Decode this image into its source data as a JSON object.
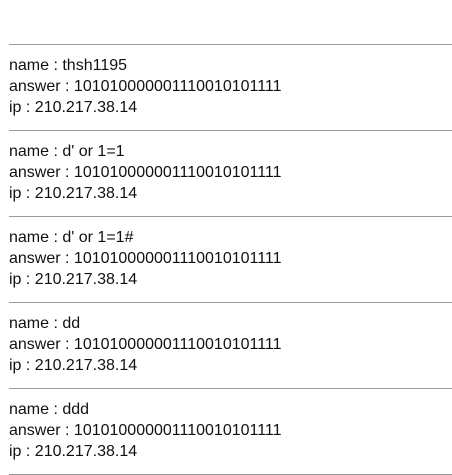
{
  "entries": [
    {
      "name_label": "name : thsh1195",
      "answer_label": "answer : 101010000001110010101111",
      "ip_label": "ip : 210.217.38.14"
    },
    {
      "name_label": "name : d' or 1=1",
      "answer_label": "answer : 101010000001110010101111",
      "ip_label": "ip : 210.217.38.14"
    },
    {
      "name_label": "name : d' or 1=1#",
      "answer_label": "answer : 101010000001110010101111",
      "ip_label": "ip : 210.217.38.14"
    },
    {
      "name_label": "name : dd",
      "answer_label": "answer : 101010000001110010101111",
      "ip_label": "ip : 210.217.38.14"
    },
    {
      "name_label": "name : ddd",
      "answer_label": "answer : 101010000001110010101111",
      "ip_label": "ip : 210.217.38.14"
    }
  ]
}
